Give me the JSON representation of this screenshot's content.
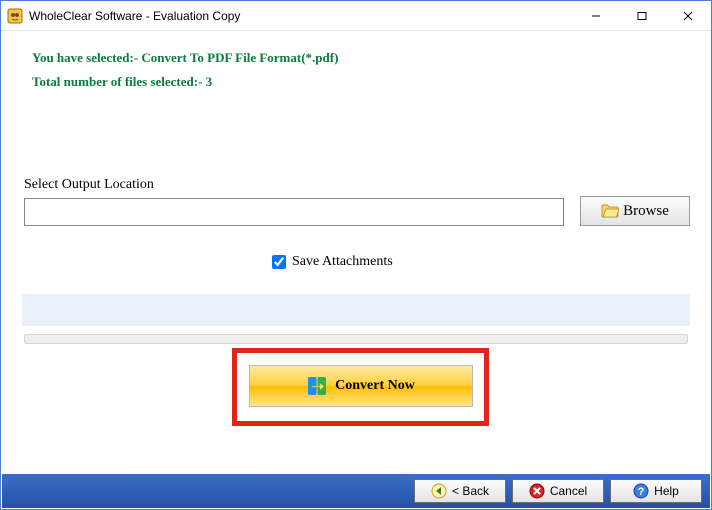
{
  "title": "WholeClear Software - Evaluation Copy",
  "info": {
    "line1": "You have selected:- Convert To PDF File Format(*.pdf)",
    "line2": "Total number of files selected:- 3"
  },
  "output": {
    "label": "Select Output Location",
    "value": "",
    "browse_label": "Browse"
  },
  "save_attachments": {
    "label": "Save Attachments",
    "checked": true
  },
  "convert_label": "Convert Now",
  "footer": {
    "back": "< Back",
    "cancel": "Cancel",
    "help": "Help"
  }
}
